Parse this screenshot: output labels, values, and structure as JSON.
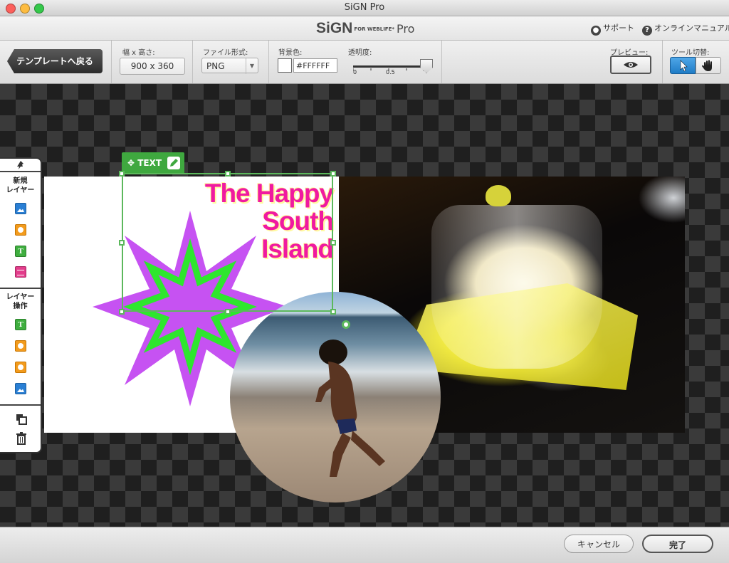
{
  "window": {
    "title": "SiGN Pro"
  },
  "header": {
    "logo_main": "SiGN",
    "logo_small": "FOR WEBLIFE*",
    "logo_pro": "Pro",
    "support_label": "サポート",
    "manual_label": "オンラインマニュアル"
  },
  "toolbar": {
    "back_label": "テンプレートへ戻る",
    "size_label": "幅 x 高さ:",
    "size_value": "900 x 360",
    "format_label": "ファイル形式:",
    "format_value": "PNG",
    "bgcolor_label": "背景色:",
    "bgcolor_value": "#FFFFFF",
    "opacity_label": "透明度:",
    "opacity_tick_min": "0",
    "opacity_tick_mid": "0.5",
    "opacity_value": 1.0,
    "preview_label": "プレビュー:",
    "tool_switch_label": "ツール切替:",
    "active_tool": "pointer"
  },
  "layer_panel": {
    "new_layer_title_1": "新規",
    "new_layer_title_2": "レイヤー",
    "new_layer_items": [
      "image-icon",
      "shape-icon",
      "text-icon",
      "table-icon"
    ],
    "layer_ops_title_1": "レイヤー",
    "layer_ops_title_2": "操作",
    "layer_ops_items": [
      "text-icon",
      "shape-icon",
      "shape-icon",
      "image-icon"
    ]
  },
  "stage": {
    "headline_line1": "The Happy",
    "headline_line2": "South",
    "headline_line3": "Island",
    "selection_tag": "TEXT",
    "colors": {
      "headline": "#f01aa0",
      "star_outer": "#c652f2",
      "star_inner": "#2ee62e",
      "selection": "#5cb85c"
    }
  },
  "footer": {
    "cancel_label": "キャンセル",
    "done_label": "完了"
  }
}
